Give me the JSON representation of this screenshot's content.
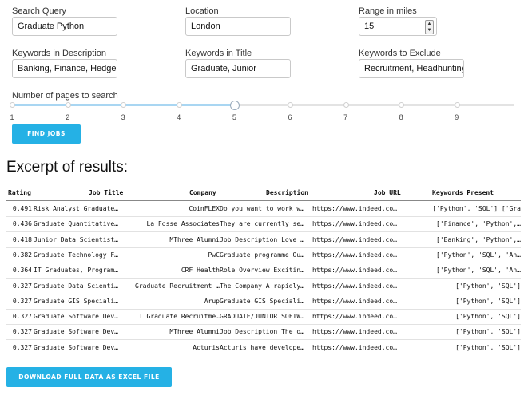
{
  "form": {
    "search_query": {
      "label": "Search Query",
      "value": "Graduate Python"
    },
    "location": {
      "label": "Location",
      "value": "London"
    },
    "range": {
      "label": "Range in miles",
      "value": "15"
    },
    "keywords_description": {
      "label": "Keywords in Description",
      "value": "Banking, Finance, Hedge, P"
    },
    "keywords_title": {
      "label": "Keywords in Title",
      "value": "Graduate, Junior"
    },
    "keywords_exclude": {
      "label": "Keywords to Exclude",
      "value": "Recruitment, Headhunting"
    }
  },
  "pages_slider": {
    "label": "Number of pages to search",
    "ticks": [
      "1",
      "2",
      "3",
      "4",
      "5",
      "6",
      "7",
      "8",
      "9"
    ],
    "value": 5
  },
  "find_button": "FIND JOBS",
  "results_title": "Excerpt of results:",
  "table": {
    "columns": [
      "Rating",
      "Job Title",
      "Company",
      "Description",
      "Job URL",
      "Keywords Present"
    ],
    "rows": [
      [
        "0.491",
        "Risk Analyst Graduate…",
        "CoinFLEX",
        "Do you want to work w…",
        "https://www.indeed.co…",
        "['Python', 'SQL'] ['Gra"
      ],
      [
        "0.436",
        "Graduate Quantitative…",
        "La Fosse Associates",
        "They are currently se…",
        "https://www.indeed.co…",
        "['Finance', 'Python',…"
      ],
      [
        "0.418",
        "Junior Data Scientist…",
        "MThree Alumni",
        "Job Description Love …",
        "https://www.indeed.co…",
        "['Banking', 'Python',…"
      ],
      [
        "0.382",
        "Graduate Technology F…",
        "PwC",
        "Graduate programme Ou…",
        "https://www.indeed.co…",
        "['Python', 'SQL', 'An…"
      ],
      [
        "0.364",
        "IT Graduates, Program…",
        "CRF Health",
        "Role Overview Excitin…",
        "https://www.indeed.co…",
        "['Python', 'SQL', 'An…"
      ],
      [
        "0.327",
        "Graduate Data Scienti…",
        "Graduate Recruitment …",
        "The Company A rapidly…",
        "https://www.indeed.co…",
        "['Python', 'SQL']"
      ],
      [
        "0.327",
        "Graduate GIS Speciali…",
        "Arup",
        "Graduate GIS Speciali…",
        "https://www.indeed.co…",
        "['Python', 'SQL']"
      ],
      [
        "0.327",
        "Graduate Software Dev…",
        "IT Graduate Recruitme…",
        "GRADUATE/JUNIOR SOFTW…",
        "https://www.indeed.co…",
        "['Python', 'SQL']"
      ],
      [
        "0.327",
        "Graduate Software Dev…",
        "MThree Alumni",
        "Job Description The o…",
        "https://www.indeed.co…",
        "['Python', 'SQL']"
      ],
      [
        "0.327",
        "Graduate Software Dev…",
        "Acturis",
        "Acturis have develope…",
        "https://www.indeed.co…",
        "['Python', 'SQL']"
      ]
    ]
  },
  "download_button": "DOWNLOAD FULL DATA AS EXCEL FILE",
  "colors": {
    "accent": "#25b1e5",
    "slider_fill": "#a9d6f2"
  }
}
